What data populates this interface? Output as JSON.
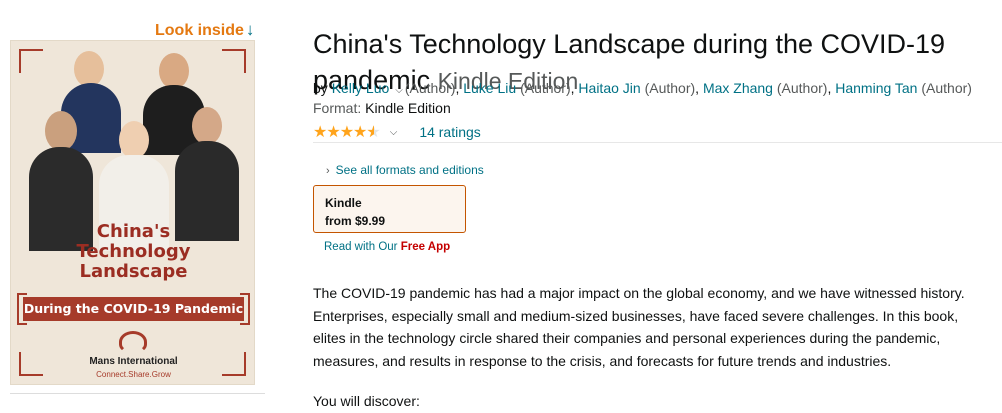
{
  "look_inside": {
    "label": "Look inside",
    "arrow": "↓"
  },
  "cover": {
    "title_lines": [
      "China's",
      "Technology",
      "Landscape"
    ],
    "banner": "During the COVID-19 Pandemic",
    "brand": "Mans International",
    "tagline": "Connect.Share.Grow"
  },
  "product": {
    "title": "China's Technology Landscape during the COVID-19 pandemic",
    "edition": "Kindle Edition"
  },
  "byline": {
    "prefix": "by",
    "authors": [
      {
        "name": "Kelly Luo",
        "role": "(Author)"
      },
      {
        "name": "Luke Liu",
        "role": "(Author)"
      },
      {
        "name": "Haitao Jin",
        "role": "(Author)"
      },
      {
        "name": "Max Zhang",
        "role": "(Author)"
      },
      {
        "name": "Hanming Tan",
        "role": "(Author)"
      }
    ]
  },
  "format": {
    "label": "Format:",
    "value": "Kindle Edition"
  },
  "rating": {
    "stars": 4.6,
    "count_label": "14 ratings",
    "star_color": "#ffa41c"
  },
  "formats": {
    "see_all": "See all formats and editions",
    "selected_name": "Kindle",
    "selected_price": "from $9.99",
    "read_with": "Read with Our",
    "free_app": "Free App"
  },
  "description": {
    "paragraph": "The COVID-19 pandemic has had a major impact on the global economy, and we have witnessed history. Enterprises, especially small and medium-sized businesses, have faced severe challenges. In this book, elites in the technology circle shared their companies and personal experiences during the pandemic, measures, and results in response to the crisis, and forecasts for future trends and industries.",
    "discover": "You will discover:"
  },
  "colors": {
    "link": "#007185",
    "accent_orange": "#e47911",
    "cover_red": "#a63b2a"
  }
}
